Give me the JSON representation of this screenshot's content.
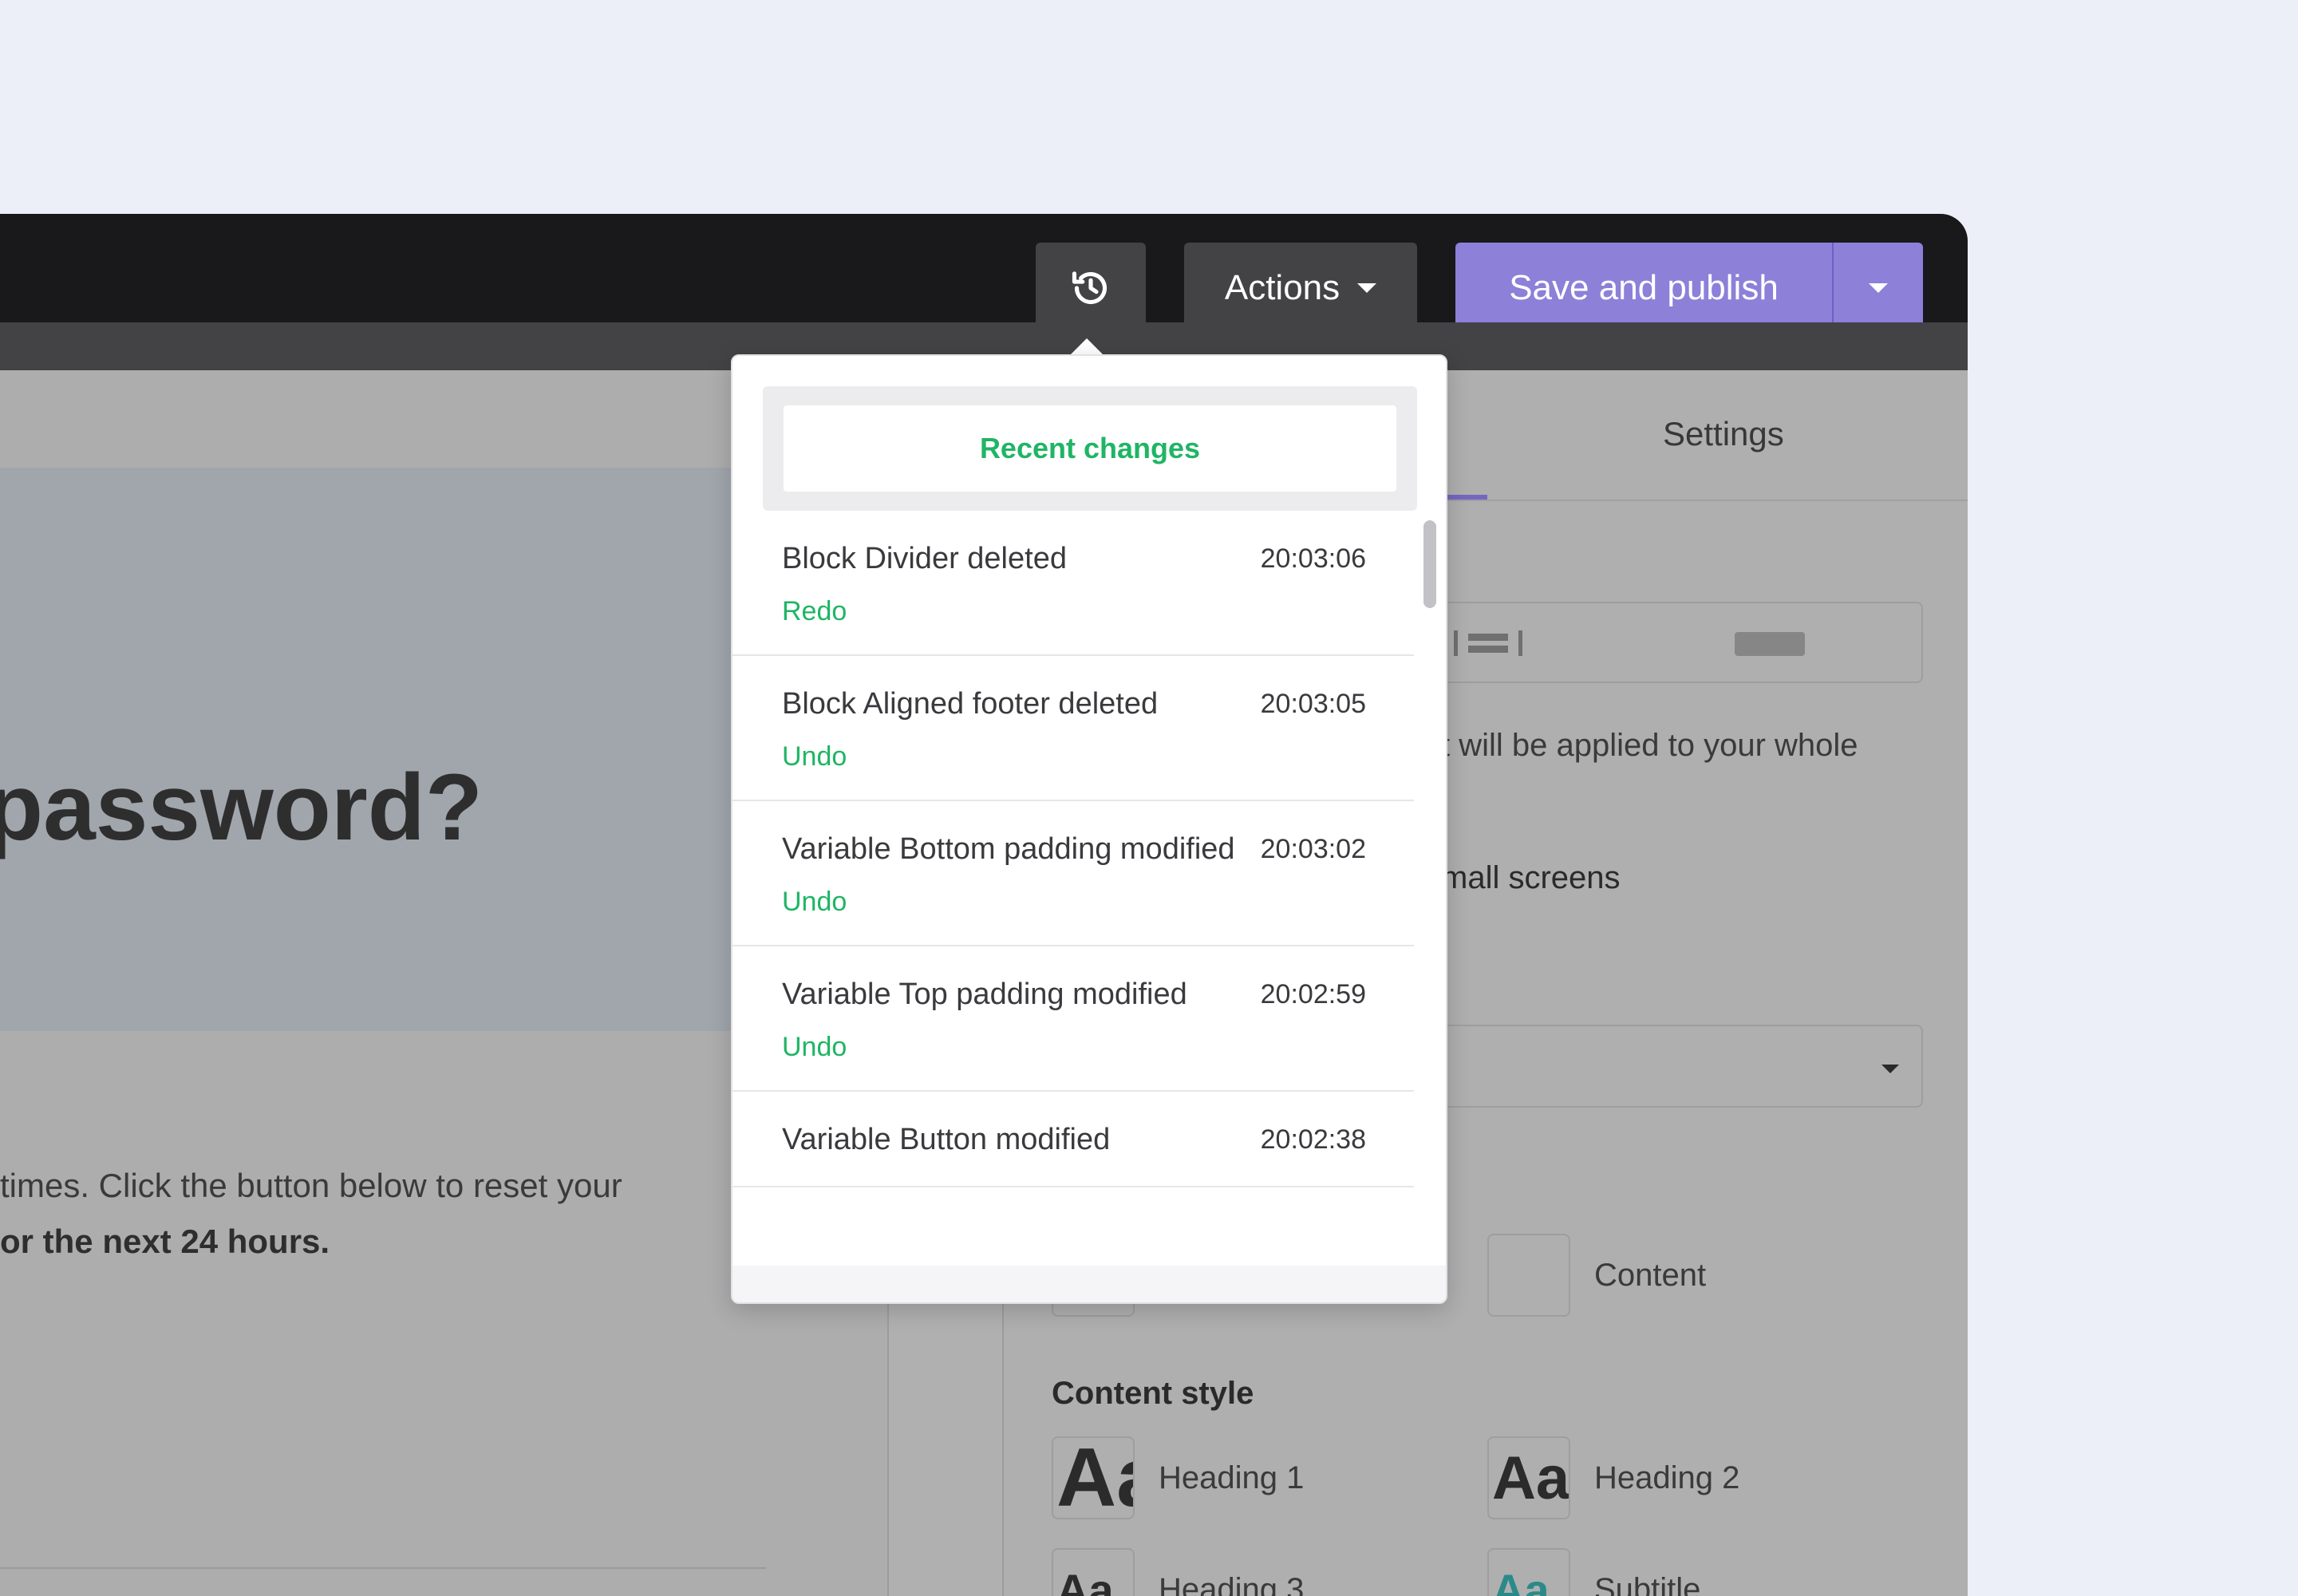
{
  "toolbar": {
    "history_icon": "history-icon",
    "actions_label": "Actions",
    "publish_label": "Save and publish"
  },
  "canvas": {
    "heading_fragment": "password?",
    "text_line_1": "times. Click the button below to reset your",
    "text_line_2": "or the next 24 hours."
  },
  "settings": {
    "tab_settings": "Settings",
    "help_fragment": "t will be applied to your whole",
    "toggle_fragment": "mall screens",
    "content_label": "Content",
    "content_style_title": "Content style",
    "styles": [
      {
        "sample": "Aa",
        "label": "Heading 1"
      },
      {
        "sample": "Aa",
        "label": "Heading 2"
      },
      {
        "sample": "Aa",
        "label": "Heading 3"
      },
      {
        "sample": "Aa",
        "label": "Subtitle"
      }
    ]
  },
  "history": {
    "tab_label": "Recent changes",
    "items": [
      {
        "title": "Block Divider deleted",
        "time": "20:03:06",
        "action": "Redo"
      },
      {
        "title": "Block Aligned footer deleted",
        "time": "20:03:05",
        "action": "Undo"
      },
      {
        "title": "Variable Bottom padding modified",
        "time": "20:03:02",
        "action": "Undo"
      },
      {
        "title": "Variable Top padding modified",
        "time": "20:02:59",
        "action": "Undo"
      },
      {
        "title": "Variable Button modified",
        "time": "20:02:38",
        "action": ""
      }
    ]
  },
  "colors": {
    "accent_green": "#1fb564",
    "publish_purple": "#8c80d9",
    "topbar": "#19191b"
  }
}
